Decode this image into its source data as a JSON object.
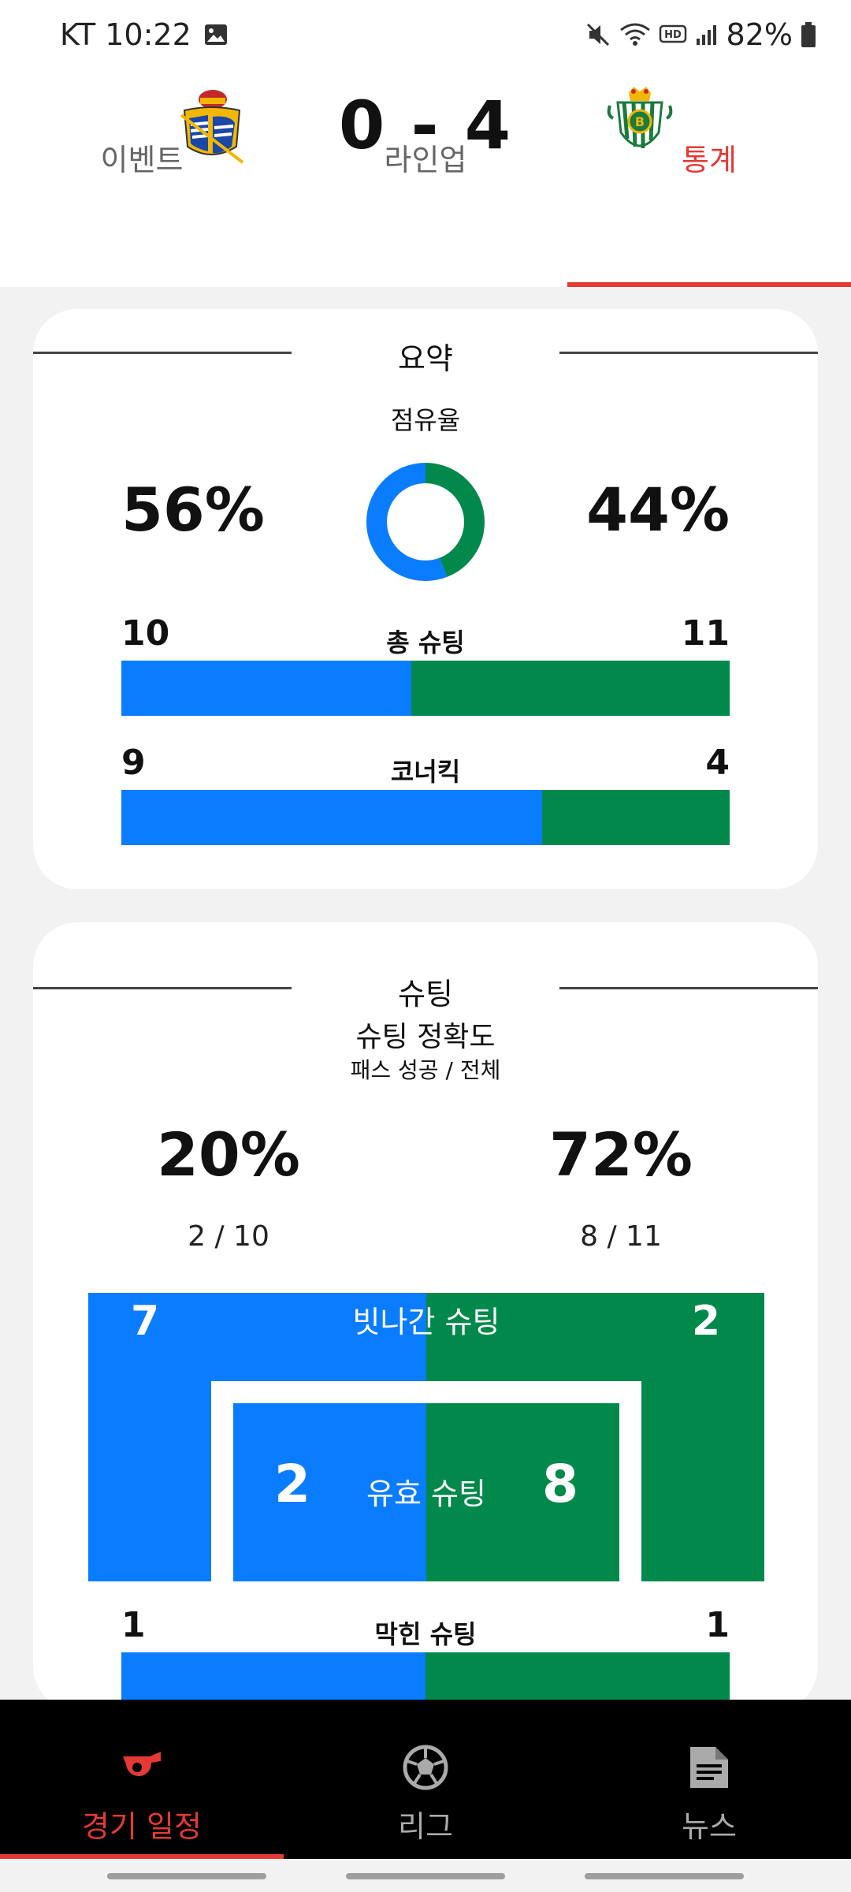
{
  "status_bar": {
    "carrier_time": "KT 10:22",
    "battery": "82%"
  },
  "match": {
    "score": "0 - 4"
  },
  "tabs": [
    {
      "label": "이벤트"
    },
    {
      "label": "라인업"
    },
    {
      "label": "통계"
    }
  ],
  "summary": {
    "title": "요약",
    "possession_label": "점유율",
    "home_possession": "56%",
    "away_possession": "44%",
    "home_possession_value": 56,
    "away_possession_value": 44,
    "total_shots": {
      "label": "총 슈팅",
      "home": "10",
      "away": "11"
    },
    "corners": {
      "label": "코너킥",
      "home": "9",
      "away": "4"
    }
  },
  "shooting": {
    "title": "슈팅",
    "accuracy_title": "슈팅 정확도",
    "accuracy_sub": "패스 성공 / 전체",
    "home_pct": "20%",
    "away_pct": "72%",
    "home_frac": "2 / 10",
    "away_frac": "8 / 11",
    "off_target_label": "빗나간 슈팅",
    "off_target_home": "7",
    "off_target_away": "2",
    "on_target_label": "유효 슈팅",
    "on_target_home": "2",
    "on_target_away": "8",
    "blocked": {
      "label": "막힌 슈팅",
      "home": "1",
      "away": "1"
    }
  },
  "colors": {
    "home": "#0a7cff",
    "away": "#00894a",
    "accent": "#e53935"
  },
  "bottom_nav": [
    {
      "label": "경기 일정",
      "icon": "whistle-icon"
    },
    {
      "label": "리그",
      "icon": "soccer-ball-icon"
    },
    {
      "label": "뉴스",
      "icon": "news-document-icon"
    }
  ]
}
